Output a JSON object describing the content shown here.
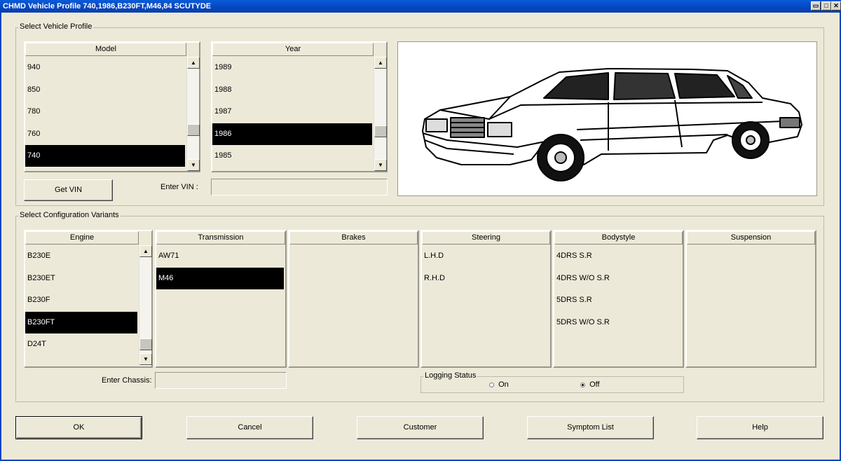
{
  "window": {
    "title": "CHMD Vehicle Profile 740,1986,B230FT,M46,84 SCUTYDE",
    "restore_glyph": "▭",
    "maximize_glyph": "□",
    "close_glyph": "✕"
  },
  "profile": {
    "group_label": "Select Vehicle Profile",
    "model": {
      "header": "Model",
      "items": [
        "940",
        "850",
        "780",
        "760",
        "740"
      ],
      "selected_index": 4
    },
    "year": {
      "header": "Year",
      "items": [
        "1989",
        "1988",
        "1987",
        "1986",
        "1985"
      ],
      "selected_index": 3
    },
    "get_vin_label": "Get VIN",
    "enter_vin_label": "Enter VIN :",
    "vin_value": ""
  },
  "config": {
    "group_label": "Select Configuration Variants",
    "engine": {
      "header": "Engine",
      "items": [
        "B230E",
        "B230ET",
        "B230F",
        "B230FT",
        "D24T"
      ],
      "selected_index": 3
    },
    "transmission": {
      "header": "Transmission",
      "items": [
        "AW71",
        "M46"
      ],
      "selected_index": 1
    },
    "brakes": {
      "header": "Brakes",
      "items": []
    },
    "steering": {
      "header": "Steering",
      "items": [
        "L.H.D",
        "R.H.D"
      ]
    },
    "bodystyle": {
      "header": "Bodystyle",
      "items": [
        "4DRS S.R",
        "4DRS W/O S.R",
        "5DRS S.R",
        "5DRS W/O S.R"
      ]
    },
    "suspension": {
      "header": "Suspension",
      "items": []
    },
    "enter_chassis_label": "Enter Chassis:",
    "chassis_value": "",
    "logging": {
      "label": "Logging Status",
      "on_label": "On",
      "off_label": "Off",
      "selected": "Off"
    }
  },
  "buttons": {
    "ok": "OK",
    "cancel": "Cancel",
    "customer": "Customer",
    "symptom_list": "Symptom List",
    "help": "Help"
  },
  "scroll_glyphs": {
    "up": "▲",
    "down": "▼"
  }
}
